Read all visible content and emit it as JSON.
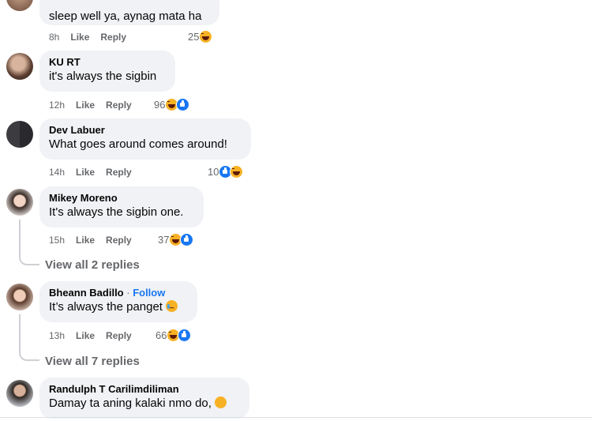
{
  "comments": [
    {
      "name": "",
      "text": "sleep well ya, aynag mata ha",
      "time": "8h",
      "like": "Like",
      "reply": "Reply",
      "count": "25",
      "reactions": [
        "haha"
      ]
    },
    {
      "name": "KU RT",
      "text": "it's always the sigbin",
      "time": "12h",
      "like": "Like",
      "reply": "Reply",
      "count": "96",
      "reactions": [
        "haha",
        "like"
      ]
    },
    {
      "name": "Dev Labuer",
      "text": "What goes around comes around!",
      "time": "14h",
      "like": "Like",
      "reply": "Reply",
      "count": "10",
      "reactions": [
        "like",
        "haha"
      ]
    },
    {
      "name": "Mikey Moreno",
      "text": "It's always the sigbin one.",
      "time": "15h",
      "like": "Like",
      "reply": "Reply",
      "count": "37",
      "reactions": [
        "haha",
        "like"
      ],
      "view_replies": "View all 2 replies"
    },
    {
      "name": "Bheann Badillo",
      "follow": "Follow",
      "separator": " · ",
      "text": "It’s always the panget",
      "text_emoji": "crying-face",
      "time": "13h",
      "like": "Like",
      "reply": "Reply",
      "count": "66",
      "reactions": [
        "haha",
        "like"
      ],
      "view_replies": "View all 7 replies"
    },
    {
      "name": "Randulph T Carilimdiliman",
      "text": "Damay ta aning kalaki nmo do,",
      "text_emoji": "sad-face"
    }
  ],
  "colors": {
    "bubble": "#f0f2f5",
    "secondary_text": "#65676b",
    "link_blue": "#1877f2",
    "haha_yellow": "#f7b125"
  }
}
